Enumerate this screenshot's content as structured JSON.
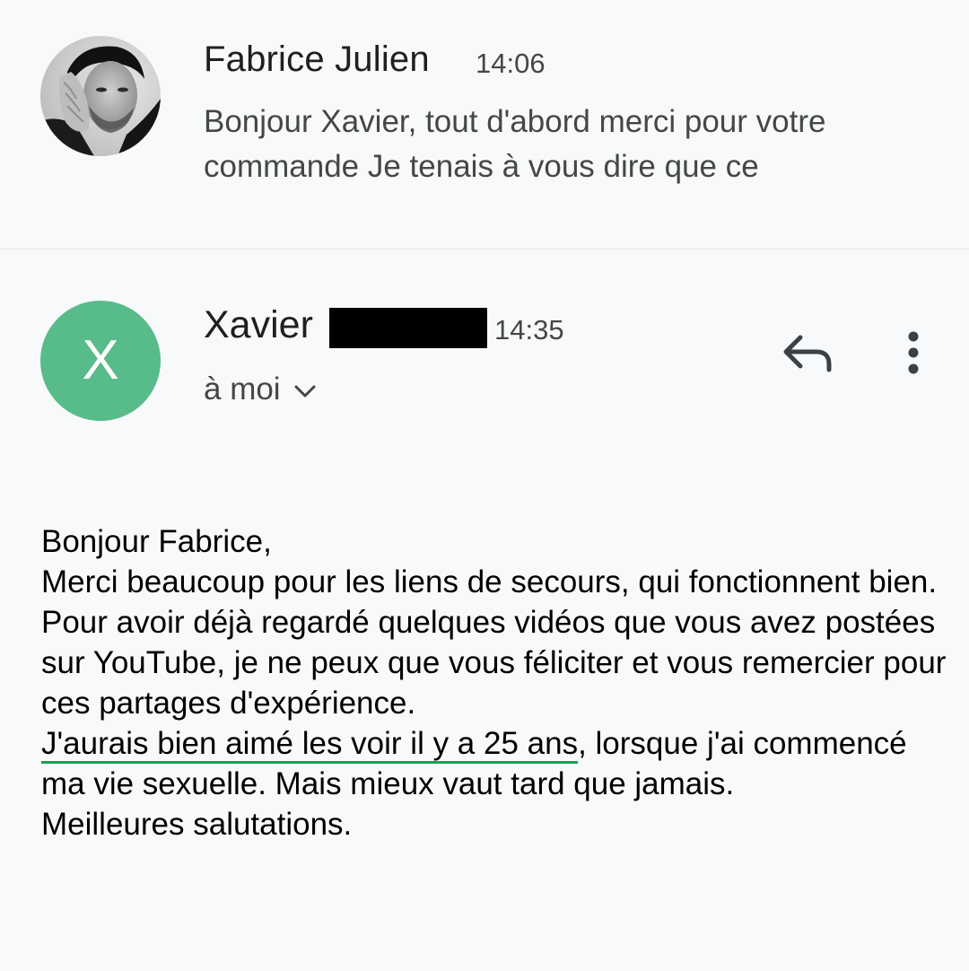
{
  "collapsed_message": {
    "sender": "Fabrice Julien",
    "time": "14:06",
    "snippet": "Bonjour Xavier, tout d'abord merci pour votre commande Je tenais à vous dire que ce"
  },
  "expanded_message": {
    "avatar_letter": "X",
    "avatar_color": "#57bb8a",
    "sender": "Xavier",
    "time": "14:35",
    "recipient": "à moi",
    "actions": {
      "reply_icon": "reply-icon",
      "more_icon": "more-vert-icon",
      "expand_icon": "chevron-down-icon"
    },
    "body": {
      "line1": "Bonjour Fabrice,",
      "line2": "Merci beaucoup pour les liens de secours, qui fonctionnent bien.",
      "line3": "Pour avoir déjà regardé quelques vidéos que vous avez postées sur YouTube, je ne peux que vous féliciter et vous remercier pour ces partages d'expérience.",
      "line4_highlighted": "J'aurais bien aimé les voir il y a 25 ans",
      "line4_rest": ", lorsque j'ai commencé ma vie sexuelle. Mais mieux vaut tard que jamais.",
      "line5": "Meilleures salutations."
    }
  },
  "colors": {
    "background": "#f8f9fb",
    "underline": "#1e9e52",
    "secondary_text": "#444746"
  }
}
